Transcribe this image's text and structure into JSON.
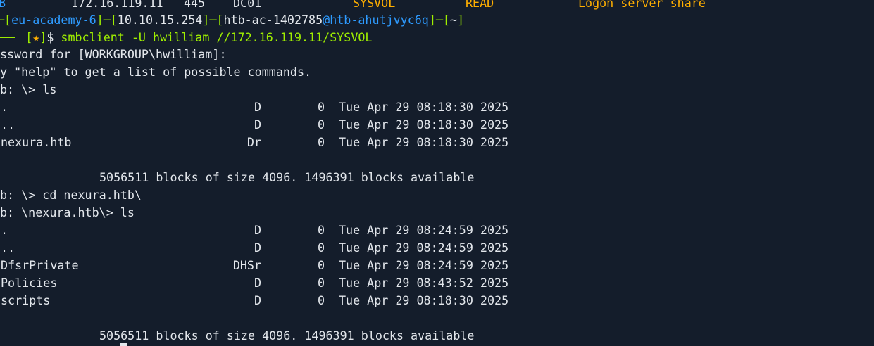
{
  "share_row": {
    "c1": "B",
    "c2": "172.16.119.11",
    "c3": "445",
    "c4": "DC01",
    "c5": "SYSVOL",
    "c6": "READ",
    "c7": "Logon server share"
  },
  "prompt": {
    "lead": "─",
    "region": "eu-academy-6",
    "sep1": "─",
    "ip": "10.10.15.254",
    "sep2": "─",
    "user": "htb-ac-1402785",
    "at": "@",
    "host": "htb-ahutjvyc6q",
    "sep3": "─",
    "path": "~",
    "arrow": "──╴",
    "star": "★",
    "symbol": "$",
    "command": "smbclient -U hwilliam //172.16.119.11/SYSVOL"
  },
  "lines": {
    "password": "ssword for [WORKGROUP\\hwilliam]:",
    "help": "y \"help\" to get a list of possible commands.",
    "cmd_ls1": "b: \\> ls",
    "blocks1": "5056511 blocks of size 4096. 1496391 blocks available",
    "cmd_cd": "b: \\> cd nexura.htb\\",
    "cmd_ls2": "b: \\nexura.htb\\> ls",
    "blocks2": "5056511 blocks of size 4096. 1496391 blocks available"
  },
  "listing1": [
    {
      "name": ".",
      "attr": "D",
      "size": "0",
      "date": "Tue Apr 29 08:18:30 2025"
    },
    {
      "name": "..",
      "attr": "D",
      "size": "0",
      "date": "Tue Apr 29 08:18:30 2025"
    },
    {
      "name": "nexura.htb",
      "attr": "Dr",
      "size": "0",
      "date": "Tue Apr 29 08:18:30 2025"
    }
  ],
  "listing2": [
    {
      "name": ".",
      "attr": "D",
      "size": "0",
      "date": "Tue Apr 29 08:24:59 2025"
    },
    {
      "name": "..",
      "attr": "D",
      "size": "0",
      "date": "Tue Apr 29 08:24:59 2025"
    },
    {
      "name": "DfsrPrivate",
      "attr": "DHSr",
      "size": "0",
      "date": "Tue Apr 29 08:24:59 2025"
    },
    {
      "name": "Policies",
      "attr": "D",
      "size": "0",
      "date": "Tue Apr 29 08:43:52 2025"
    },
    {
      "name": "scripts",
      "attr": "D",
      "size": "0",
      "date": "Tue Apr 29 08:18:30 2025"
    }
  ],
  "colors": {
    "background": "#141d2b",
    "text": "#e3e7ec",
    "green": "#9fef00",
    "blue": "#2e9bff",
    "orange": "#ffaf00"
  }
}
